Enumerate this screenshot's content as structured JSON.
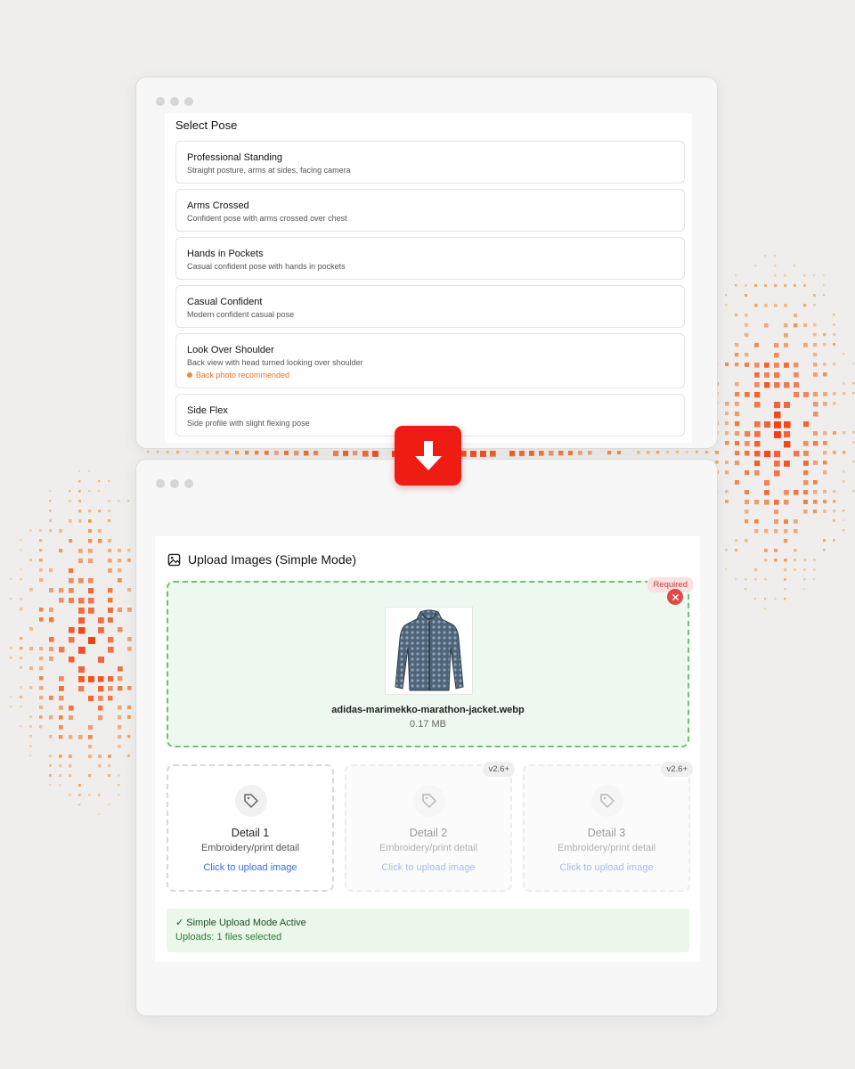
{
  "pose_section": {
    "title": "Select Pose",
    "poses": [
      {
        "name": "Professional Standing",
        "desc": "Straight posture, arms at sides, facing camera"
      },
      {
        "name": "Arms Crossed",
        "desc": "Confident pose with arms crossed over chest"
      },
      {
        "name": "Hands in Pockets",
        "desc": "Casual confident pose with hands in pockets"
      },
      {
        "name": "Casual Confident",
        "desc": "Modern confident casual pose"
      },
      {
        "name": "Look Over Shoulder",
        "desc": "Back view with head turned looking over shoulder",
        "note": "Back photo recommended"
      },
      {
        "name": "Side Flex",
        "desc": "Side profile with slight flexing pose"
      }
    ]
  },
  "upload": {
    "title": "Upload Images (Simple Mode)",
    "required_badge": "Required",
    "file": {
      "name": "adidas-marimekko-marathon-jacket.webp",
      "size": "0.17 MB"
    },
    "details": [
      {
        "title": "Detail 1",
        "sub": "Embroidery/print detail",
        "link": "Click to upload image",
        "version": ""
      },
      {
        "title": "Detail 2",
        "sub": "Embroidery/print detail",
        "link": "Click to upload image",
        "version": "v2.6+"
      },
      {
        "title": "Detail 3",
        "sub": "Embroidery/print detail",
        "link": "Click to upload image",
        "version": "v2.6+"
      }
    ],
    "status": {
      "title": "✓ Simple Upload Mode Active",
      "sub": "Uploads: 1 files selected"
    }
  },
  "colors": {
    "accent": "#ee1c12",
    "success": "#6cc36f",
    "link": "#3b6fe0",
    "warning": "#e8742c"
  },
  "icons": {
    "arrow": "arrow-down-icon",
    "image": "image-icon",
    "tag": "tag-icon",
    "close": "close-icon"
  }
}
